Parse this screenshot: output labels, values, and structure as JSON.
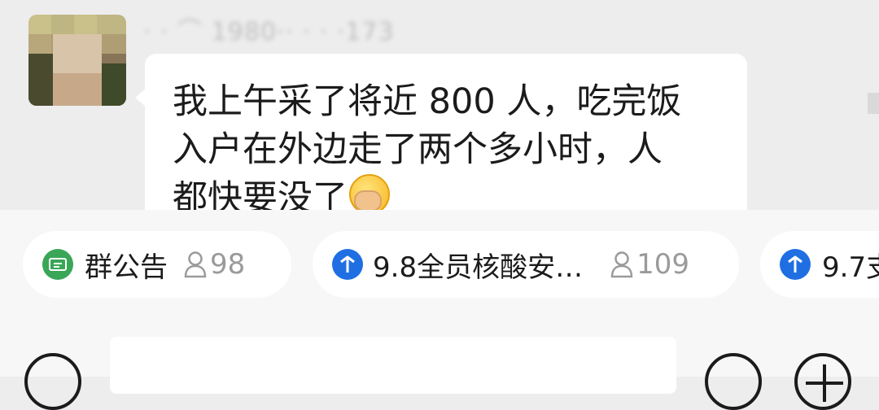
{
  "message": {
    "sender_name": "· · ⌒ 1980·· · · ·173",
    "text_line1": "我上午采了将近 800 人，吃完饭",
    "text_line2": "入户在外边走了两个多小时，人",
    "text_line3": "都快要没了",
    "emoji": "face-palm-emoji"
  },
  "pills": [
    {
      "icon": "announcement-icon",
      "label": "群公告",
      "count": "98"
    },
    {
      "icon": "pin-icon",
      "label": "9.8全员核酸安…",
      "count": "109"
    },
    {
      "icon": "pin-icon",
      "label": "9.7支",
      "count": ""
    }
  ],
  "input_bar": {
    "voice_icon": "voice-icon",
    "emoji_icon": "smile-icon",
    "plus_icon": "plus-icon"
  },
  "colors": {
    "background": "#ededed",
    "bubble": "#ffffff",
    "announcement_green": "#3aa658",
    "pin_blue": "#1f6fe3",
    "muted_gray": "#9a9a9a"
  }
}
